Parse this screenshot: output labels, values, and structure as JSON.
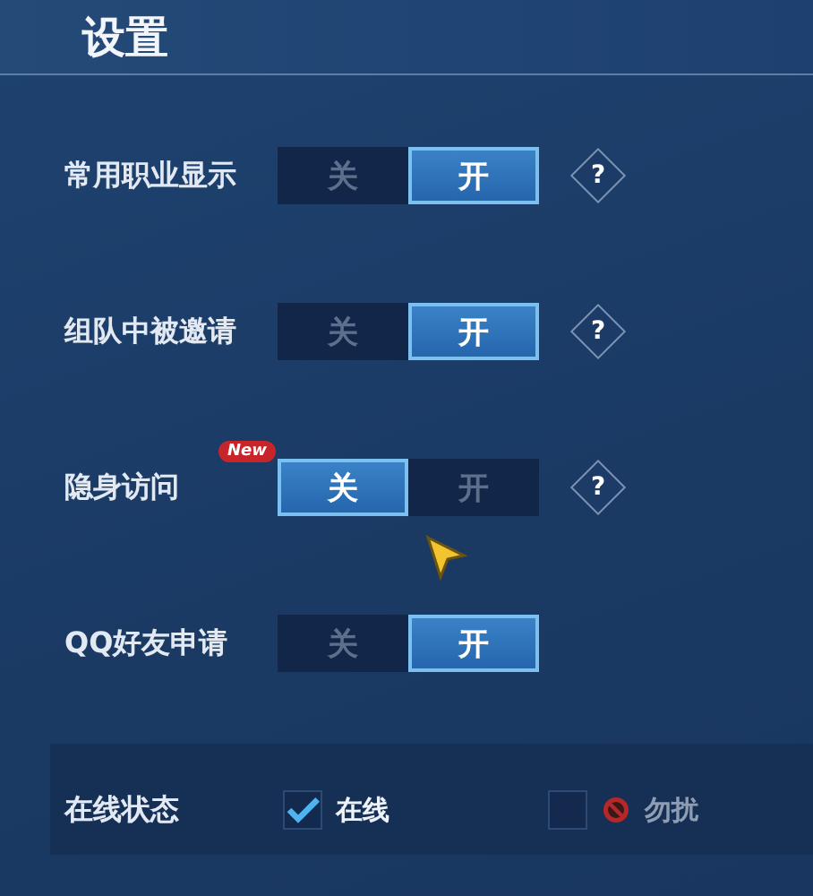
{
  "window": {
    "title": "设置"
  },
  "settings": [
    {
      "label": "常用职业显示",
      "help": "?",
      "options": [
        {
          "label": "关",
          "selected": false
        },
        {
          "label": "开",
          "selected": true
        }
      ]
    },
    {
      "label": "组队中被邀请",
      "help": "?",
      "options": [
        {
          "label": "关",
          "selected": false
        },
        {
          "label": "开",
          "selected": true
        }
      ]
    },
    {
      "label": "隐身访问",
      "badge": "New",
      "help": "?",
      "options": [
        {
          "label": "关",
          "selected": true
        },
        {
          "label": "开",
          "selected": false
        }
      ]
    },
    {
      "label": "QQ好友申请",
      "options": [
        {
          "label": "关",
          "selected": false
        },
        {
          "label": "开",
          "selected": true
        }
      ]
    }
  ],
  "online_status": {
    "label": "在线状态",
    "choices": [
      {
        "kind": "online",
        "label": "在线",
        "checked": true
      },
      {
        "kind": "busy",
        "label": "勿扰",
        "checked": false
      }
    ]
  }
}
